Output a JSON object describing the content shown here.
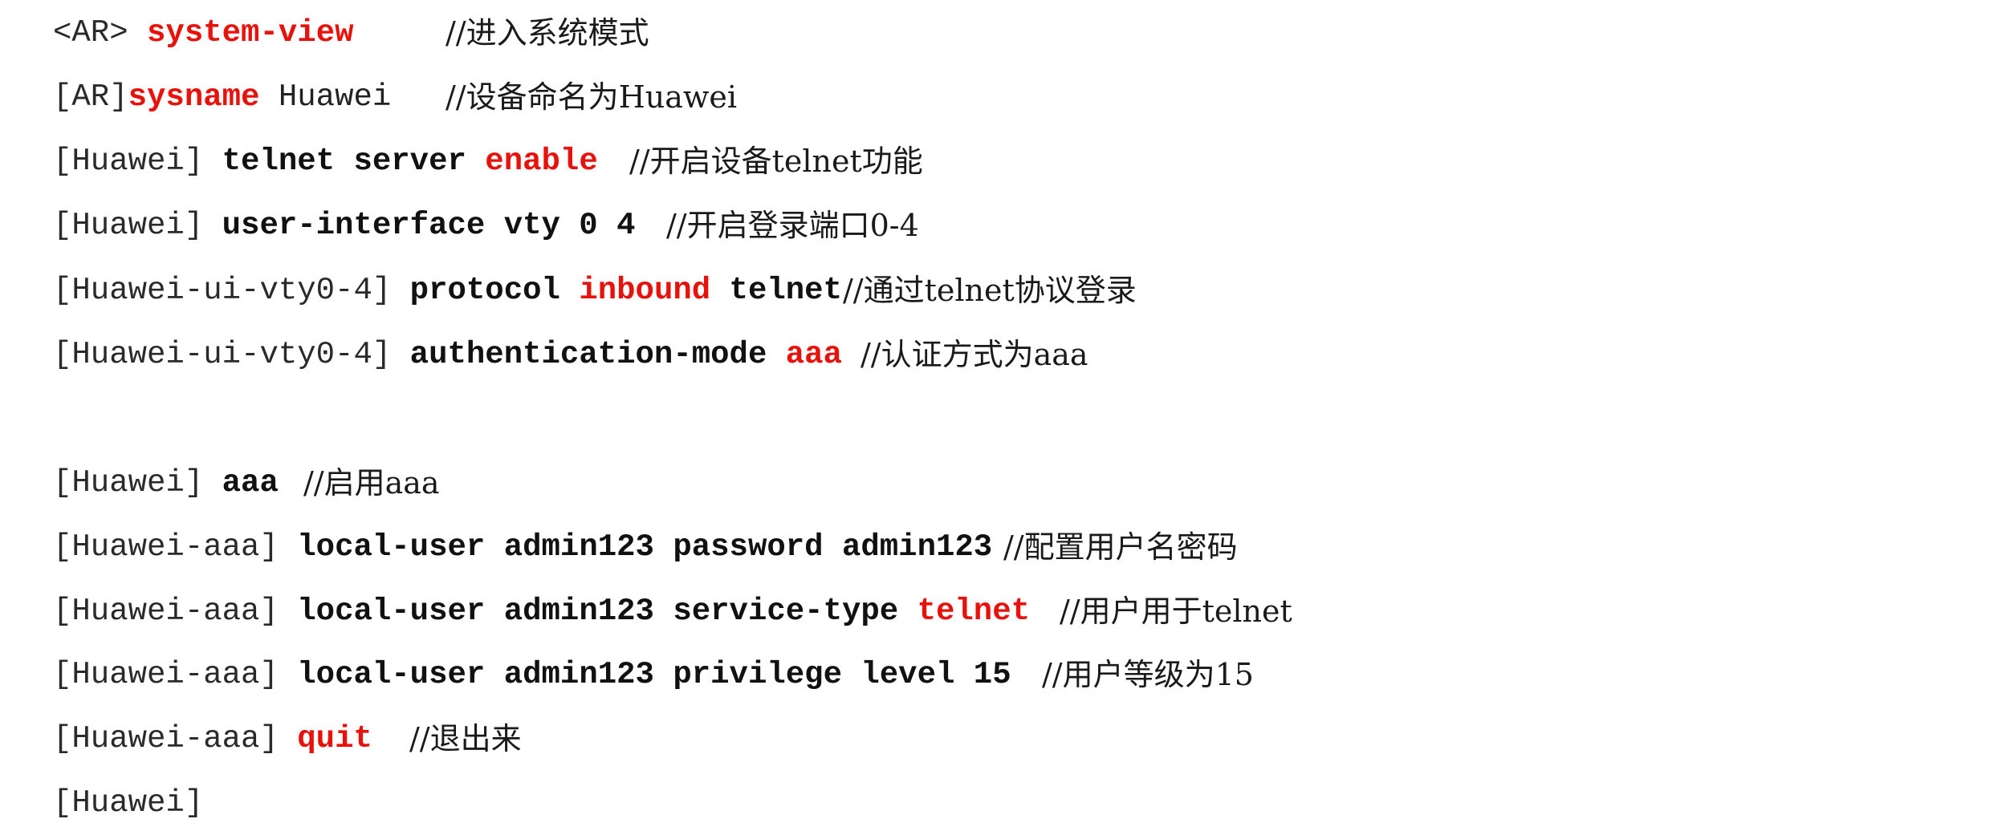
{
  "colors": {
    "keyword": "#e8120c",
    "text": "#1a1a1a",
    "background": "#ffffff"
  },
  "lines": [
    {
      "prompt": "<AR>",
      "parts": [
        {
          "text": " ",
          "style": "arg"
        },
        {
          "text": "system-view",
          "style": "kw"
        }
      ],
      "comment": "//进入系统模式"
    },
    {
      "prompt": "[AR]",
      "parts": [
        {
          "text": "sysname",
          "style": "kw"
        },
        {
          "text": " Huawei",
          "style": "arg"
        }
      ],
      "comment": "//设备命名为Huawei"
    },
    {
      "prompt": "[Huawei]",
      "parts": [
        {
          "text": " telnet server ",
          "style": "cmd"
        },
        {
          "text": "enable",
          "style": "kw"
        }
      ],
      "comment": "//开启设备telnet功能"
    },
    {
      "prompt": "[Huawei]",
      "parts": [
        {
          "text": " user-interface vty 0 4",
          "style": "cmd"
        }
      ],
      "comment": "//开启登录端口0-4"
    },
    {
      "prompt": "[Huawei-ui-vty0-4]",
      "parts": [
        {
          "text": " protocol ",
          "style": "cmd"
        },
        {
          "text": "inbound",
          "style": "kw"
        },
        {
          "text": " telnet",
          "style": "cmd"
        }
      ],
      "comment": "//通过telnet协议登录"
    },
    {
      "prompt": "[Huawei-ui-vty0-4]",
      "parts": [
        {
          "text": " authentication-mode ",
          "style": "cmd"
        },
        {
          "text": "aaa",
          "style": "kw"
        }
      ],
      "comment": "//认证方式为aaa"
    },
    {
      "prompt": "[Huawei]",
      "parts": [
        {
          "text": " aaa",
          "style": "cmd"
        }
      ],
      "comment": "//启用aaa"
    },
    {
      "prompt": "[Huawei-aaa]",
      "parts": [
        {
          "text": " local-user admin123 password admin123",
          "style": "cmd"
        }
      ],
      "comment": "//配置用户名密码"
    },
    {
      "prompt": "[Huawei-aaa]",
      "parts": [
        {
          "text": " local-user admin123 service-type ",
          "style": "cmd"
        },
        {
          "text": "telnet",
          "style": "kw"
        }
      ],
      "comment": "//用户用于telnet"
    },
    {
      "prompt": "[Huawei-aaa]",
      "parts": [
        {
          "text": " local-user admin123 privilege level 15",
          "style": "cmd"
        }
      ],
      "comment": "//用户等级为15"
    },
    {
      "prompt": "[Huawei-aaa]",
      "parts": [
        {
          "text": " ",
          "style": "arg"
        },
        {
          "text": "quit",
          "style": "kw"
        }
      ],
      "comment": "//退出来"
    },
    {
      "prompt": "[Huawei]",
      "parts": [],
      "comment": ""
    }
  ]
}
